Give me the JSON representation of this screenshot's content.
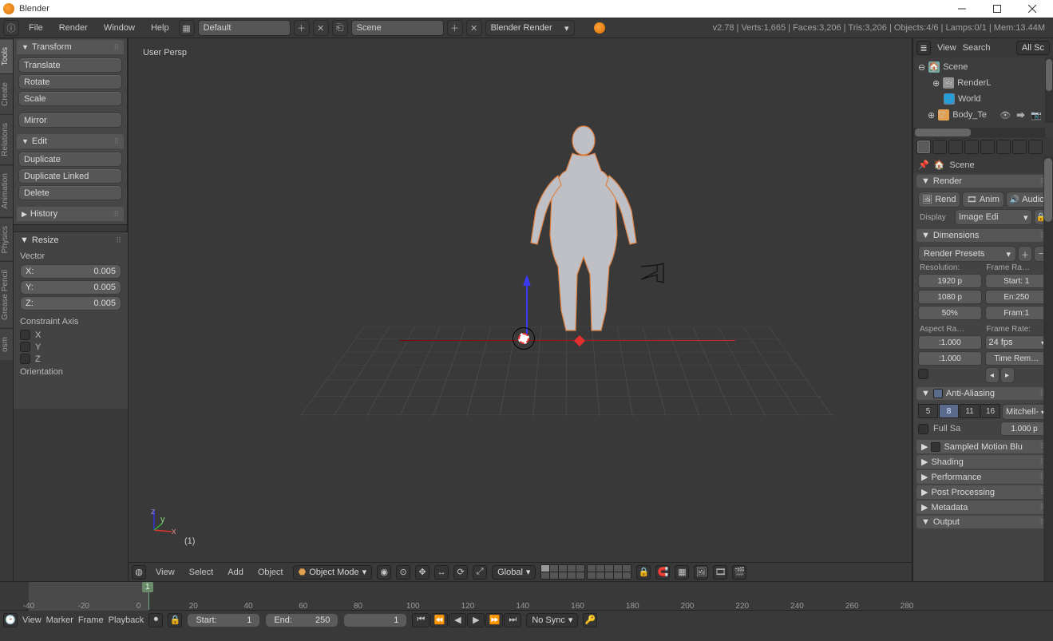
{
  "window": {
    "title": "Blender"
  },
  "infobar": {
    "menus": [
      "File",
      "Render",
      "Window",
      "Help"
    ],
    "layout": "Default",
    "scene": "Scene",
    "engine": "Blender Render",
    "stats": "v2.78 | Verts:1,665 | Faces:3,206 | Tris:3,206 | Objects:4/6 | Lamps:0/1 | Mem:13.44M"
  },
  "vtabs": [
    "Tools",
    "Create",
    "Relations",
    "Animation",
    "Physics",
    "Grease Pencil",
    "osm"
  ],
  "toolshelf": {
    "transform": {
      "title": "Transform",
      "items": [
        "Translate",
        "Rotate",
        "Scale",
        "Mirror"
      ]
    },
    "edit": {
      "title": "Edit",
      "items": [
        "Duplicate",
        "Duplicate Linked",
        "Delete"
      ]
    },
    "history": {
      "title": "History"
    }
  },
  "operator": {
    "title": "Resize",
    "vector_label": "Vector",
    "x": {
      "l": "X:",
      "v": "0.005"
    },
    "y": {
      "l": "Y:",
      "v": "0.005"
    },
    "z": {
      "l": "Z:",
      "v": "0.005"
    },
    "constraint_label": "Constraint Axis",
    "axes": [
      "X",
      "Y",
      "Z"
    ],
    "orientation_label": "Orientation"
  },
  "viewport": {
    "label": "User Persp",
    "frame": "(1)",
    "menus": [
      "View",
      "Select",
      "Add",
      "Object"
    ],
    "mode": "Object Mode",
    "orientation": "Global"
  },
  "timeline": {
    "ticks": [
      "-40",
      "-20",
      "0",
      "20",
      "40",
      "60",
      "80",
      "100",
      "120",
      "140",
      "160",
      "180",
      "200",
      "220",
      "240",
      "260",
      "280"
    ],
    "current": "1",
    "menus": [
      "View",
      "Marker",
      "Frame",
      "Playback"
    ],
    "start": {
      "l": "Start:",
      "v": "1"
    },
    "end": {
      "l": "End:",
      "v": "250"
    },
    "cur": {
      "l": "",
      "v": "1"
    },
    "sync": "No Sync"
  },
  "outliner": {
    "menus": [
      "View",
      "Search"
    ],
    "all": "All Sc",
    "rows": [
      {
        "indent": 0,
        "icon": "scene",
        "label": "Scene"
      },
      {
        "indent": 1,
        "icon": "render",
        "label": "RenderL"
      },
      {
        "indent": 1,
        "icon": "world",
        "label": "World"
      },
      {
        "indent": 1,
        "icon": "mesh",
        "label": "Body_Te"
      }
    ]
  },
  "props": {
    "crumb_pin": "📌",
    "crumb_scene": "Scene",
    "render": {
      "title": "Render",
      "buttons": [
        "Rend",
        "Anim",
        "Audio"
      ],
      "display_lbl": "Display",
      "display_val": "Image Edi"
    },
    "dimensions": {
      "title": "Dimensions",
      "presets": "Render Presets",
      "res_lbl": "Resolution:",
      "frame_lbl": "Frame Ra…",
      "res_x": "1920 p",
      "res_y": "1080 p",
      "res_pct": "50%",
      "start": "Start: 1",
      "end": "En:250",
      "step": "Fram:1",
      "aspect_lbl": "Aspect Ra…",
      "rate_lbl": "Frame Rate:",
      "aspect_x": ":1.000",
      "aspect_y": ":1.000",
      "fps": "24 fps",
      "remap": "Time Rem…"
    },
    "aa": {
      "title": "Anti-Aliasing",
      "choices": [
        "5",
        "8",
        "11",
        "16"
      ],
      "filter": "Mitchell-",
      "full": "Full Sa",
      "size": "1.000 p"
    },
    "collapsed": [
      "Sampled Motion Blu",
      "Shading",
      "Performance",
      "Post Processing",
      "Metadata",
      "Output"
    ]
  }
}
